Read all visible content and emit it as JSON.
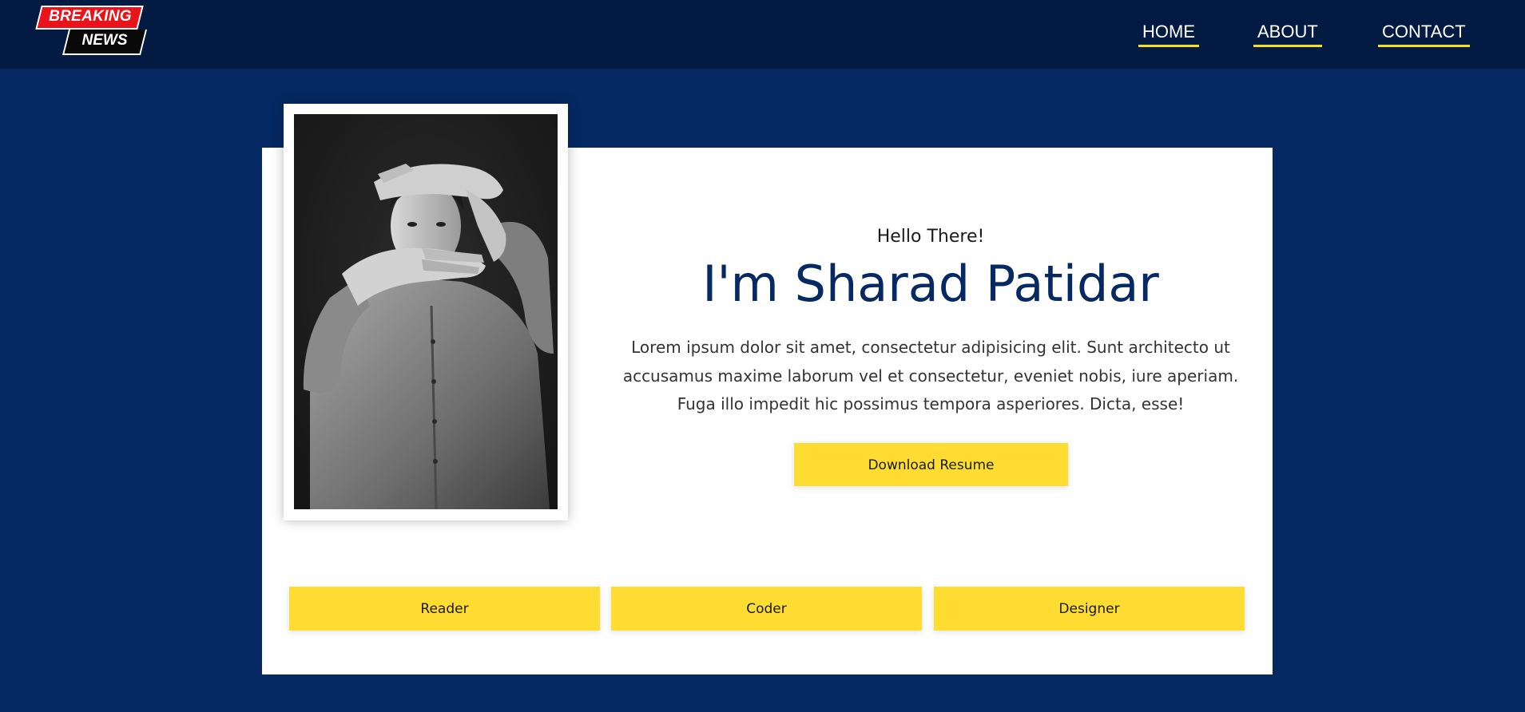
{
  "logo": {
    "line1": "BREAKING",
    "line2": "NEWS",
    "colors": {
      "red": "#e8141a",
      "black": "#0a0a0a"
    }
  },
  "nav": {
    "items": [
      {
        "label": "HOME"
      },
      {
        "label": "ABOUT"
      },
      {
        "label": "CONTACT"
      }
    ],
    "underline_color": "#f7e11f"
  },
  "hero": {
    "greeting": "Hello There!",
    "name": "I'm Sharad Patidar",
    "description": "Lorem ipsum dolor sit amet, consectetur adipisicing elit. Sunt architecto ut accusamus maxime laborum vel et consectetur, eveniet nobis, iure aperiam. Fuga illo impedit hic possimus tempora asperiores. Dicta, esse!",
    "resume_button": "Download Resume"
  },
  "roles": [
    {
      "label": "Reader"
    },
    {
      "label": "Coder"
    },
    {
      "label": "Designer"
    }
  ],
  "photo": {
    "icon": "portrait-photo",
    "subject": "black-and-white portrait of a man framing his face with his hands"
  },
  "colors": {
    "page_bg": "#062963",
    "header_bg": "#031a43",
    "accent_yellow": "#fedc32",
    "name_color": "#062963"
  }
}
